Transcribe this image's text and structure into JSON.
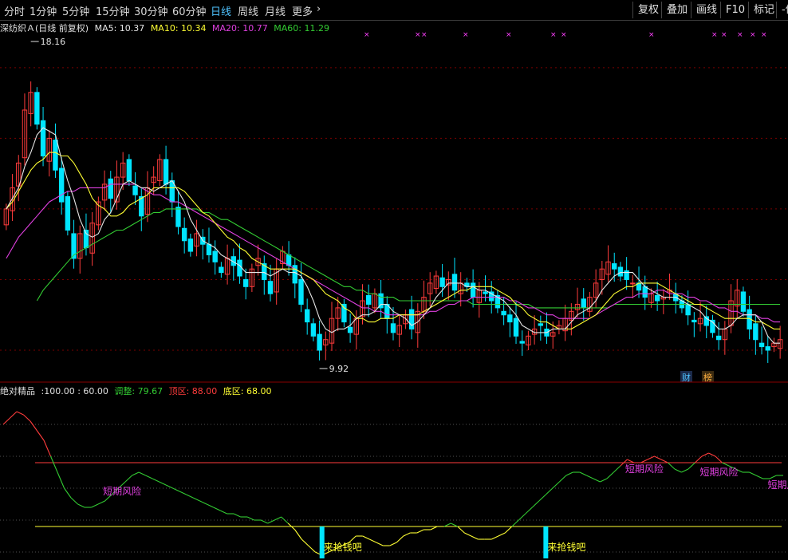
{
  "toolbar": {
    "tabs": [
      "分时",
      "1分钟",
      "5分钟",
      "15分钟",
      "30分钟",
      "60分钟",
      "日线",
      "周线",
      "月线",
      "更多"
    ],
    "active_tab": "日线",
    "more_icon": "chevron-right-icon",
    "buttons": [
      "复权",
      "叠加",
      "画线",
      "F10",
      "标记",
      "-份"
    ]
  },
  "colors": {
    "up": "#ff3c3c",
    "down": "#00e5ff",
    "ma5": "#e6e6e6",
    "ma10": "#ffff33",
    "ma20": "#e040e0",
    "ma60": "#33cc33",
    "grid": "#7a0000",
    "risk_text": "#e040e0"
  },
  "main_legend": {
    "title": "深纺织Ａ(日线 前复权)",
    "ma5": "MA5: 10.37",
    "ma10": "MA10: 10.34",
    "ma20": "MA20: 10.77",
    "ma60": "MA60: 11.29"
  },
  "sub_legend": {
    "name": "绝对精品",
    "params": ":100.00 : 60.00",
    "adjust": "调整: 79.67",
    "top": "顶区: 88.00",
    "bottom": "底区: 68.00"
  },
  "badges": {
    "cai": "财",
    "bang": "榜"
  },
  "chart_data": [
    {
      "type": "candlestick",
      "title": "深纺织Ａ(日线 前复权)",
      "ylim": [
        9.3,
        18.9
      ],
      "high_label": "18.16",
      "low_label": "9.92",
      "series_keys": [
        "close",
        "ma5",
        "ma10",
        "ma20",
        "ma60"
      ],
      "close": [
        14.0,
        14.6,
        15.3,
        16.8,
        17.3,
        16.4,
        15.5,
        16.0,
        15.1,
        14.2,
        13.4,
        12.6,
        13.3,
        12.9,
        13.6,
        14.2,
        14.7,
        14.3,
        14.9,
        15.3,
        14.8,
        14.4,
        13.8,
        14.6,
        14.9,
        15.4,
        14.7,
        14.2,
        13.5,
        13.1,
        12.8,
        13.3,
        13.0,
        12.7,
        12.5,
        12.2,
        12.6,
        12.4,
        12.1,
        11.8,
        12.3,
        12.6,
        12.0,
        11.6,
        12.3,
        12.8,
        12.4,
        11.9,
        11.3,
        10.8,
        10.4,
        10.0,
        10.3,
        10.9,
        11.2,
        10.8,
        10.5,
        10.9,
        11.4,
        11.3,
        11.6,
        11.2,
        10.9,
        10.5,
        10.7,
        11.0,
        10.6,
        11.1,
        11.5,
        11.9,
        12.1,
        11.8,
        12.0,
        11.7,
        11.9,
        11.8,
        11.5,
        11.7,
        11.6,
        11.4,
        11.2,
        11.0,
        10.8,
        10.4,
        10.2,
        10.4,
        10.6,
        10.7,
        10.4,
        10.5,
        10.7,
        10.9,
        11.1,
        11.3,
        11.2,
        11.5,
        11.9,
        12.3,
        12.5,
        12.3,
        12.1,
        12.0,
        11.9,
        11.7,
        11.5,
        11.6,
        11.4,
        11.5,
        11.7,
        11.4,
        11.2,
        11.0,
        10.8,
        10.9,
        10.7,
        10.5,
        10.3,
        10.6,
        11.4,
        11.7,
        11.1,
        10.6,
        10.3,
        10.1,
        10.0,
        10.2,
        10.3
      ],
      "ma5": [
        14.0,
        14.3,
        14.6,
        15.2,
        15.6,
        16.1,
        16.3,
        16.2,
        16.1,
        15.4,
        14.8,
        14.3,
        13.7,
        13.3,
        13.2,
        13.3,
        13.7,
        13.9,
        14.3,
        14.7,
        14.8,
        14.7,
        14.6,
        14.6,
        14.5,
        14.6,
        14.7,
        14.8,
        14.5,
        14.2,
        13.7,
        13.4,
        13.1,
        13.0,
        12.9,
        12.7,
        12.6,
        12.5,
        12.4,
        12.2,
        12.2,
        12.2,
        12.2,
        12.1,
        12.2,
        12.3,
        12.2,
        12.2,
        12.1,
        11.8,
        11.4,
        10.9,
        10.6,
        10.5,
        10.6,
        10.6,
        10.7,
        10.9,
        11.0,
        11.0,
        11.1,
        11.3,
        11.3,
        11.1,
        11.0,
        10.9,
        10.7,
        10.8,
        11.0,
        11.2,
        11.5,
        11.7,
        11.9,
        11.9,
        11.9,
        11.8,
        11.8,
        11.7,
        11.7,
        11.6,
        11.5,
        11.4,
        11.2,
        11.0,
        10.7,
        10.6,
        10.5,
        10.5,
        10.5,
        10.6,
        10.6,
        10.6,
        10.8,
        11.0,
        11.1,
        11.2,
        11.4,
        11.7,
        11.9,
        12.1,
        12.2,
        12.2,
        12.2,
        12.0,
        11.8,
        11.7,
        11.6,
        11.5,
        11.5,
        11.5,
        11.4,
        11.3,
        11.2,
        11.1,
        10.9,
        10.8,
        10.6,
        10.6,
        10.7,
        10.9,
        11.0,
        11.0,
        11.0,
        10.8,
        10.4,
        10.2,
        10.2
      ],
      "ma10": [
        14.0,
        14.2,
        14.5,
        14.8,
        15.1,
        15.3,
        15.4,
        15.6,
        15.6,
        15.5,
        15.5,
        15.3,
        15.0,
        14.7,
        14.3,
        14.1,
        14.0,
        13.8,
        13.8,
        13.9,
        14.1,
        14.2,
        14.3,
        14.4,
        14.6,
        14.6,
        14.6,
        14.6,
        14.6,
        14.5,
        14.3,
        14.1,
        13.9,
        13.8,
        13.6,
        13.4,
        13.2,
        13.1,
        12.9,
        12.8,
        12.6,
        12.5,
        12.4,
        12.3,
        12.3,
        12.3,
        12.3,
        12.3,
        12.2,
        12.1,
        12.0,
        11.8,
        11.6,
        11.5,
        11.4,
        11.2,
        11.1,
        10.9,
        10.9,
        10.8,
        10.8,
        10.9,
        10.9,
        10.9,
        11.0,
        11.0,
        11.0,
        11.0,
        11.1,
        11.2,
        11.3,
        11.4,
        11.5,
        11.6,
        11.7,
        11.7,
        11.8,
        11.8,
        11.8,
        11.8,
        11.7,
        11.6,
        11.5,
        11.3,
        11.2,
        11.0,
        10.9,
        10.8,
        10.8,
        10.7,
        10.6,
        10.6,
        10.6,
        10.7,
        10.8,
        10.9,
        11.0,
        11.2,
        11.4,
        11.6,
        11.7,
        11.8,
        11.8,
        11.9,
        11.9,
        11.9,
        11.9,
        11.8,
        11.7,
        11.6,
        11.5,
        11.4,
        11.3,
        11.3,
        11.2,
        11.1,
        11.0,
        10.9,
        10.9,
        10.9,
        10.9,
        10.9,
        10.8,
        10.8,
        10.7,
        10.6,
        10.6
      ],
      "ma20": [
        12.6,
        12.9,
        13.2,
        13.4,
        13.6,
        13.8,
        14.0,
        14.2,
        14.3,
        14.4,
        14.5,
        14.5,
        14.6,
        14.6,
        14.6,
        14.6,
        14.6,
        14.7,
        14.7,
        14.7,
        14.7,
        14.7,
        14.6,
        14.5,
        14.4,
        14.4,
        14.3,
        14.2,
        14.2,
        14.1,
        14.0,
        13.9,
        13.8,
        13.7,
        13.6,
        13.5,
        13.4,
        13.3,
        13.2,
        13.1,
        13.0,
        12.9,
        12.8,
        12.7,
        12.6,
        12.5,
        12.4,
        12.3,
        12.2,
        12.1,
        12.0,
        11.9,
        11.8,
        11.7,
        11.6,
        11.5,
        11.4,
        11.3,
        11.2,
        11.2,
        11.1,
        11.1,
        11.0,
        11.0,
        11.0,
        11.0,
        11.0,
        11.0,
        11.0,
        11.1,
        11.1,
        11.2,
        11.3,
        11.3,
        11.4,
        11.4,
        11.5,
        11.5,
        11.5,
        11.5,
        11.5,
        11.5,
        11.4,
        11.4,
        11.3,
        11.2,
        11.2,
        11.1,
        11.0,
        11.0,
        10.9,
        10.9,
        10.9,
        10.9,
        10.9,
        10.9,
        11.0,
        11.1,
        11.2,
        11.3,
        11.4,
        11.5,
        11.5,
        11.6,
        11.6,
        11.6,
        11.7,
        11.7,
        11.6,
        11.6,
        11.6,
        11.5,
        11.5,
        11.4,
        11.4,
        11.3,
        11.2,
        11.2,
        11.1,
        11.1,
        11.0,
        11.0,
        11.0,
        10.9,
        10.9,
        10.8,
        10.8
      ],
      "ma60": [
        null,
        null,
        null,
        null,
        null,
        11.4,
        11.7,
        11.9,
        12.1,
        12.3,
        12.5,
        12.7,
        12.8,
        12.9,
        13.0,
        13.1,
        13.2,
        13.3,
        13.4,
        13.4,
        13.5,
        13.6,
        13.7,
        13.8,
        13.9,
        13.9,
        14.0,
        14.0,
        14.0,
        14.0,
        14.0,
        14.0,
        13.9,
        13.9,
        13.8,
        13.7,
        13.7,
        13.6,
        13.5,
        13.4,
        13.3,
        13.2,
        13.1,
        13.0,
        12.9,
        12.8,
        12.7,
        12.6,
        12.5,
        12.4,
        12.3,
        12.2,
        12.1,
        12.0,
        11.9,
        11.8,
        11.8,
        11.7,
        11.7,
        11.6,
        11.6,
        11.5,
        11.5,
        11.5,
        11.4,
        11.4,
        11.4,
        11.4,
        11.4,
        11.4,
        11.4,
        11.4,
        11.4,
        11.4,
        11.4,
        11.4,
        11.3,
        11.3,
        11.3,
        11.3,
        11.3,
        11.3,
        11.3,
        11.3,
        11.3,
        11.3,
        11.2,
        11.2,
        11.2,
        11.2,
        11.2,
        11.2,
        11.2,
        11.2,
        11.2,
        11.2,
        11.2,
        11.2,
        11.2,
        11.3,
        11.3,
        11.3,
        11.3,
        11.3,
        11.3,
        11.3,
        11.3,
        11.3,
        11.3,
        11.3,
        11.3,
        11.3,
        11.3,
        11.3,
        11.3,
        11.3,
        11.3,
        11.3,
        11.3,
        11.3,
        11.3,
        11.3,
        11.3,
        11.3,
        11.3,
        11.3,
        11.3
      ]
    },
    {
      "type": "line",
      "title": "绝对精品",
      "ylim": [
        58,
        108
      ],
      "levels": [
        {
          "name": "顶区",
          "value": 88,
          "color": "#ff3c3c"
        },
        {
          "name": "底区",
          "value": 68,
          "color": "#ffff33"
        }
      ],
      "values": [
        100,
        102,
        104,
        103,
        101,
        98,
        95,
        90,
        85,
        80,
        77,
        75,
        74,
        74,
        75,
        76,
        78,
        80,
        82,
        84,
        85,
        84,
        83,
        82,
        81,
        80,
        79,
        78,
        77,
        76,
        75,
        74,
        73,
        72,
        72,
        71,
        71,
        70,
        70,
        69,
        70,
        71,
        69,
        67,
        64,
        62,
        60,
        59,
        60,
        61,
        62,
        63,
        65,
        65,
        64,
        63,
        62,
        62,
        63,
        65,
        66,
        66,
        67,
        67,
        68,
        68,
        69,
        68,
        66,
        65,
        64,
        64,
        64,
        65,
        66,
        68,
        70,
        72,
        74,
        76,
        78,
        80,
        82,
        84,
        85,
        85,
        84,
        83,
        82,
        83,
        85,
        87,
        89,
        88,
        88,
        89,
        90,
        89,
        88,
        86,
        85,
        86,
        88,
        90,
        91,
        90,
        88,
        87,
        86,
        85,
        85,
        84,
        83,
        83,
        84,
        84
      ],
      "annotations": [
        {
          "text": "短期风险",
          "x": 18
        },
        {
          "text": "来抢钱吧",
          "x": 47,
          "marker": true
        },
        {
          "text": "来抢钱吧",
          "x": 80,
          "marker": true
        },
        {
          "text": "短期风险",
          "x": 95
        },
        {
          "text": "短期风险",
          "x": 106
        },
        {
          "text": "短期风险",
          "x": 116
        }
      ],
      "annotation_label": "短期风险",
      "annotation_label_bottom": "来抢钱吧"
    }
  ]
}
